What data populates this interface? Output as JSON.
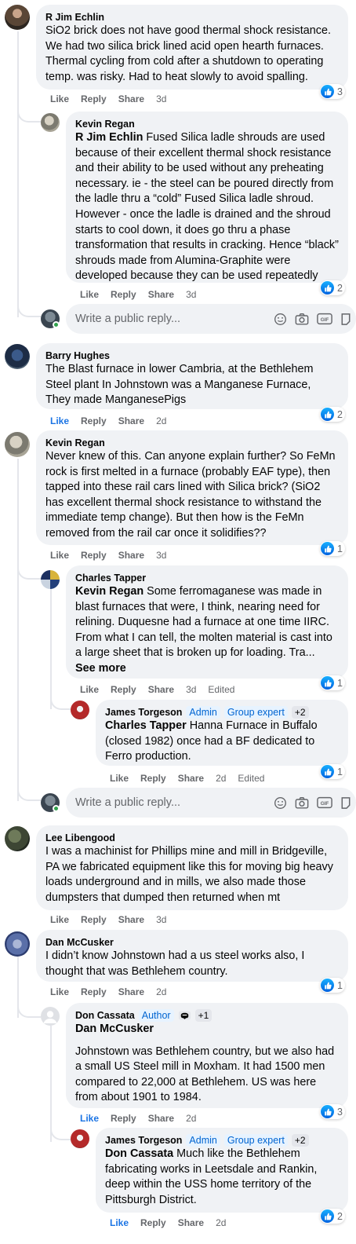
{
  "actions": {
    "like": "Like",
    "reply": "Reply",
    "share": "Share",
    "edited": "Edited",
    "see_more": "See more"
  },
  "reply_box": {
    "placeholder": "Write a public reply..."
  },
  "comments": [
    {
      "author": "R Jim Echlin",
      "text": "SiO2 brick does not have good thermal shock resistance. We had two silica brick lined acid open hearth furnaces. Thermal cycling from cold after a shutdown to operating temp. was risky. Had to heat slowly to avoid spalling.",
      "time": "3d",
      "reactions": "3"
    },
    {
      "author": "Kevin Regan",
      "mention": "R Jim Echlin",
      "text": " Fused Silica ladle shrouds are used because of their excellent thermal shock resistance and their ability to be used without any preheating necessary. ie - the steel can be poured directly from the ladle thru a “cold” Fused Silica ladle shroud. However - once the ladle is drained and the shroud starts to cool down, it does go thru a phase transformation that results in cracking. Hence “black” shrouds made from Alumina-Graphite were developed because they can be used repeatedly",
      "time": "3d",
      "reactions": "2"
    },
    {
      "author": "Barry Hughes",
      "text": "The Blast furnace in lower Cambria, at the Bethlehem Steel plant In Johnstown was a Manganese Furnace, They made ManganesePigs",
      "time": "2d",
      "reactions": "2"
    },
    {
      "author": "Kevin Regan",
      "text": "Never knew of this. Can anyone explain further? So FeMn rock is first melted in a furnace (probably EAF type), then tapped into these rail cars lined with Silica brick? (SiO2 has excellent thermal shock resistance to withstand the immediate temp change). But then how is the FeMn removed from the rail car once it solidifies??",
      "time": "3d",
      "reactions": "1"
    },
    {
      "author": "Charles Tapper",
      "mention": "Kevin Regan",
      "text": " Some ferromaganese was made in blast furnaces that were, I think, nearing need for relining. Duquesne had a furnace at one time IIRC. From what I can tell, the molten material is cast into a large sheet that is broken up for loading. Tra...",
      "time": "3d",
      "reactions": "1"
    },
    {
      "author": "James Torgeson",
      "badges": [
        "Admin",
        "Group expert",
        "+2"
      ],
      "mention": "Charles Tapper",
      "text": " Hanna Furnace in Buffalo (closed 1982) once had a BF dedicated to Ferro production.",
      "time": "2d",
      "reactions": "1"
    },
    {
      "author": "Lee Libengood",
      "text": "I was a machinist for Phillips mine and mill in Bridgeville, PA we fabricated equipment like this for moving big heavy loads underground and in mills, we also made those dumpsters that dumped then returned when mt",
      "time": "3d"
    },
    {
      "author": "Dan McCusker",
      "text": "I didn’t know Johnstown had a us steel works also, I thought that was Bethlehem country.",
      "time": "2d",
      "reactions": "1"
    },
    {
      "author": "Don Cassata",
      "badges": [
        "Author",
        "+1"
      ],
      "mention": "Dan McCusker",
      "text": "Johnstown was Bethlehem country, but we also had a small US Steel mill in Moxham. It had 1500 men compared to 22,000 at Bethlehem. US was here from about 1901 to 1984.",
      "time": "2d",
      "reactions": "3"
    },
    {
      "author": "James Torgeson",
      "badges": [
        "Admin",
        "Group expert",
        "+2"
      ],
      "mention": "Don Cassata",
      "text": " Much like the Bethlehem fabricating works in Leetsdale and Rankin, deep within the USS home territory of the Pittsburgh District.",
      "time": "2d",
      "reactions": "2"
    }
  ],
  "colors": {
    "bubble": "#f0f2f5",
    "meta": "#65676b",
    "accent": "#1b74e4",
    "badge_bg": "#e7f3ff",
    "badge_fg": "#0064d1",
    "online": "#31a24c"
  }
}
